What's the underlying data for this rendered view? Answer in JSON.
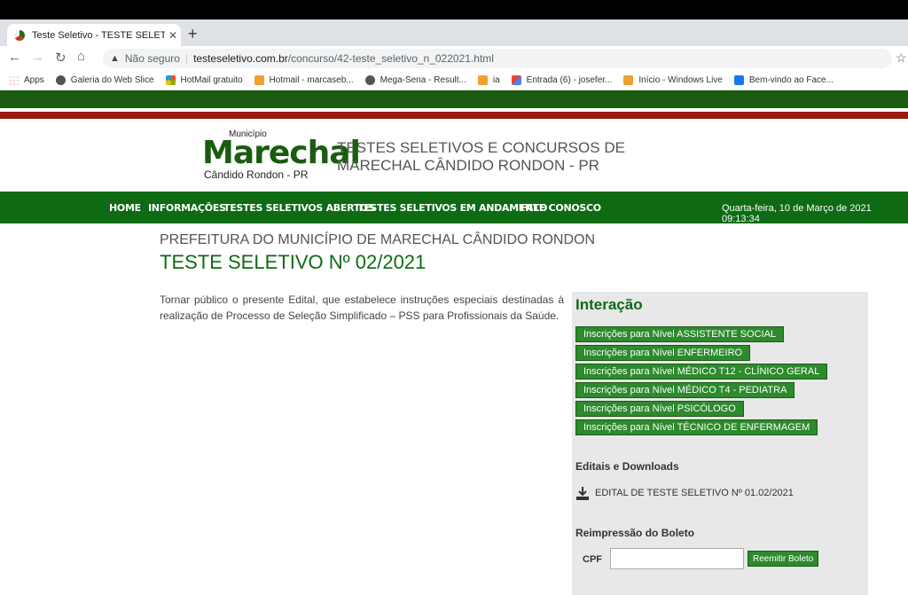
{
  "browser": {
    "tab_title": "Teste Seletivo - TESTE SELETIVO N",
    "security_label": "Não seguro",
    "url_domain": "testeseletivo.com.br",
    "url_path": "/concurso/42-teste_seletivo_n_022021.html",
    "bookmarks": [
      {
        "label": "Apps",
        "icon": "apps-grid-icon"
      },
      {
        "label": "Galeria do Web Slice",
        "icon": "globe-icon"
      },
      {
        "label": "HotMail gratuito",
        "icon": "windows-logo-icon"
      },
      {
        "label": "Hotmail - marcaseb...",
        "icon": "mail-icon"
      },
      {
        "label": "Mega-Sena - Result...",
        "icon": "globe-icon"
      },
      {
        "label": "ia",
        "icon": "mail-icon"
      },
      {
        "label": "Entrada (6) - josefer...",
        "icon": "gmail-icon"
      },
      {
        "label": "Início - Windows Live",
        "icon": "mail-icon"
      },
      {
        "label": "Bem-vindo ao Face...",
        "icon": "facebook-icon"
      }
    ]
  },
  "header": {
    "logo_small": "Município",
    "logo_main": "Marechal",
    "logo_sub": "Cândido Rondon - PR",
    "title_line1": "TESTES SELETIVOS E CONCURSOS DE",
    "title_line2": "MARECHAL CÂNDIDO RONDON - PR"
  },
  "menu": {
    "items": [
      "HOME",
      "INFORMAÇÕES",
      "TESTES SELETIVOS ABERTOS",
      "TESTES SELETIVOS EM ANDAMENTO",
      "FALE CONOSCO"
    ],
    "datetime": "Quarta-feira, 10 de Março de 2021 09:13:34"
  },
  "main": {
    "subtitle": "PREFEITURA DO MUNICÍPIO DE MARECHAL CÂNDIDO RONDON",
    "title": "TESTE SELETIVO Nº 02/2021",
    "description": "Tornar público o presente Edital, que estabelece instruções especiais destinadas à realização de Processo de Seleção Simplificado – PSS para Profissionais da Saúde."
  },
  "panel": {
    "heading": "Interação",
    "buttons": [
      "Inscrições para Nível ASSISTENTE SOCIAL",
      "Inscrições para Nível ENFERMEIRO",
      "Inscrições para Nível MÉDICO T12 - CLÍNICO GERAL",
      "Inscrições para Nível MÉDICO T4 - PEDIATRA",
      "Inscrições para Nível PSICÓLOGO",
      "Inscrições para Nível TÉCNICO DE ENFERMAGEM"
    ],
    "downloads_heading": "Editais e Downloads",
    "download_item": "EDITAL DE TESTE SELETIVO Nº 01.02/2021",
    "reprint_heading": "Reimpressão do Boleto",
    "cpf_label": "CPF",
    "cpf_value": "",
    "reprint_button": "Reemitir Boleto"
  },
  "colors": {
    "brand_green": "#0e6b14",
    "brand_red": "#9b1b12",
    "panel_bg": "#e8e8e8"
  }
}
